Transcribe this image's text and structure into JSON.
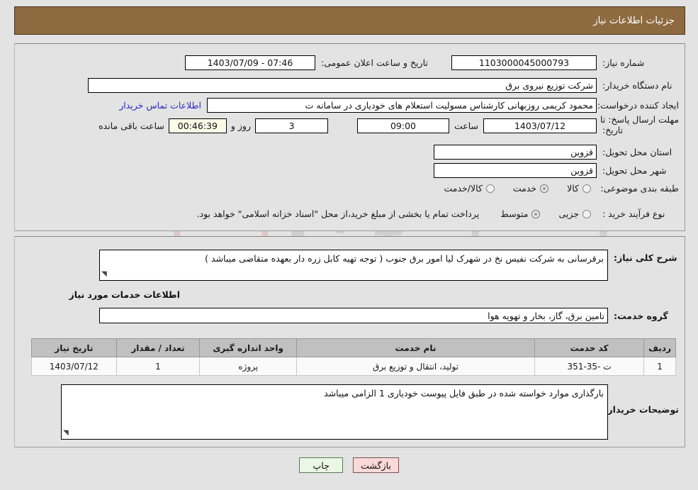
{
  "header": {
    "title": "جزئیات اطلاعات نیاز"
  },
  "form": {
    "need_number_label": "شماره نیاز:",
    "need_number_value": "1103000045000793",
    "announce_datetime_label": "تاریخ و ساعت اعلان عمومی:",
    "announce_datetime_value": "07:46 - 1403/07/09",
    "buyer_org_label": "نام دستگاه خریدار:",
    "buyer_org_value": "شرکت توزیع نیروی برق",
    "requester_label": "ایجاد کننده درخواست:",
    "requester_value": "محمود کریمی روزبهانی کارشناس  مسولیت استعلام های خودیاری در سامانه ت",
    "buyer_contact_link": "اطلاعات تماس خریدار",
    "deadline_label_line1": "مهلت ارسال پاسخ: تا",
    "deadline_label_line2": "تاریخ:",
    "deadline_date_value": "1403/07/12",
    "deadline_hour_label": "ساعت",
    "deadline_hour_value": "09:00",
    "days_value": "3",
    "days_label": "روز و",
    "countdown_value": "00:46:39",
    "countdown_label": "ساعت باقی مانده",
    "province_label": "استان محل تحویل:",
    "province_value": "قزوین",
    "city_label": "شهر محل تحویل:",
    "city_value": "قزوین",
    "category_label": "طبقه بندی موضوعی:",
    "category_options": [
      {
        "label": "کالا",
        "selected": false
      },
      {
        "label": "خدمت",
        "selected": true
      },
      {
        "label": "کالا/خدمت",
        "selected": false
      }
    ],
    "purchase_type_label": "نوع فرآیند خرید :",
    "purchase_type_options": [
      {
        "label": "جزیی",
        "selected": false
      },
      {
        "label": "متوسط",
        "selected": true
      }
    ],
    "purchase_note": "پرداخت تمام یا بخشی از مبلغ خرید،از محل \"اسناد خزانه اسلامی\" خواهد بود."
  },
  "description": {
    "label": "شرح کلی نیاز:",
    "value": "برقرسانی به شرکت نفیس نخ در شهرک لیا امور برق جنوب ( توجه تهیه کابل زره دار بعهده متقاضی میباشد )"
  },
  "services": {
    "section_title": "اطلاعات خدمات مورد نیاز",
    "group_label": "گروه خدمت:",
    "group_value": "تامین برق، گاز، بخار و تهویه هوا",
    "columns": [
      "ردیف",
      "کد خدمت",
      "نام خدمت",
      "واحد اندازه گیری",
      "تعداد / مقدار",
      "تاریخ نیاز"
    ],
    "rows": [
      {
        "index": "1",
        "code": "ت -35-351",
        "name": "تولید، انتقال و توزیع برق",
        "unit": "پروژه",
        "quantity": "1",
        "need_date": "1403/07/12"
      }
    ]
  },
  "buyer_notes": {
    "label": "توضیحات خریدار:",
    "value": "بارگذاری موارد خواسته شده در طبق فایل پیوست خودیاری 1 الزامی میباشد"
  },
  "footer": {
    "print_label": "چاپ",
    "back_label": "بازگشت"
  },
  "watermark": {
    "text": "AriaTender.net"
  },
  "colors": {
    "header_bg": "#8d6a40",
    "page_bg": "#e3e3e3",
    "link": "#2a2ac7",
    "table_header_bg": "#c0c0c0",
    "timer_bg": "#fbfbe8",
    "print_btn_bg": "#e9f7e4",
    "back_btn_bg": "#fbd9d9"
  }
}
